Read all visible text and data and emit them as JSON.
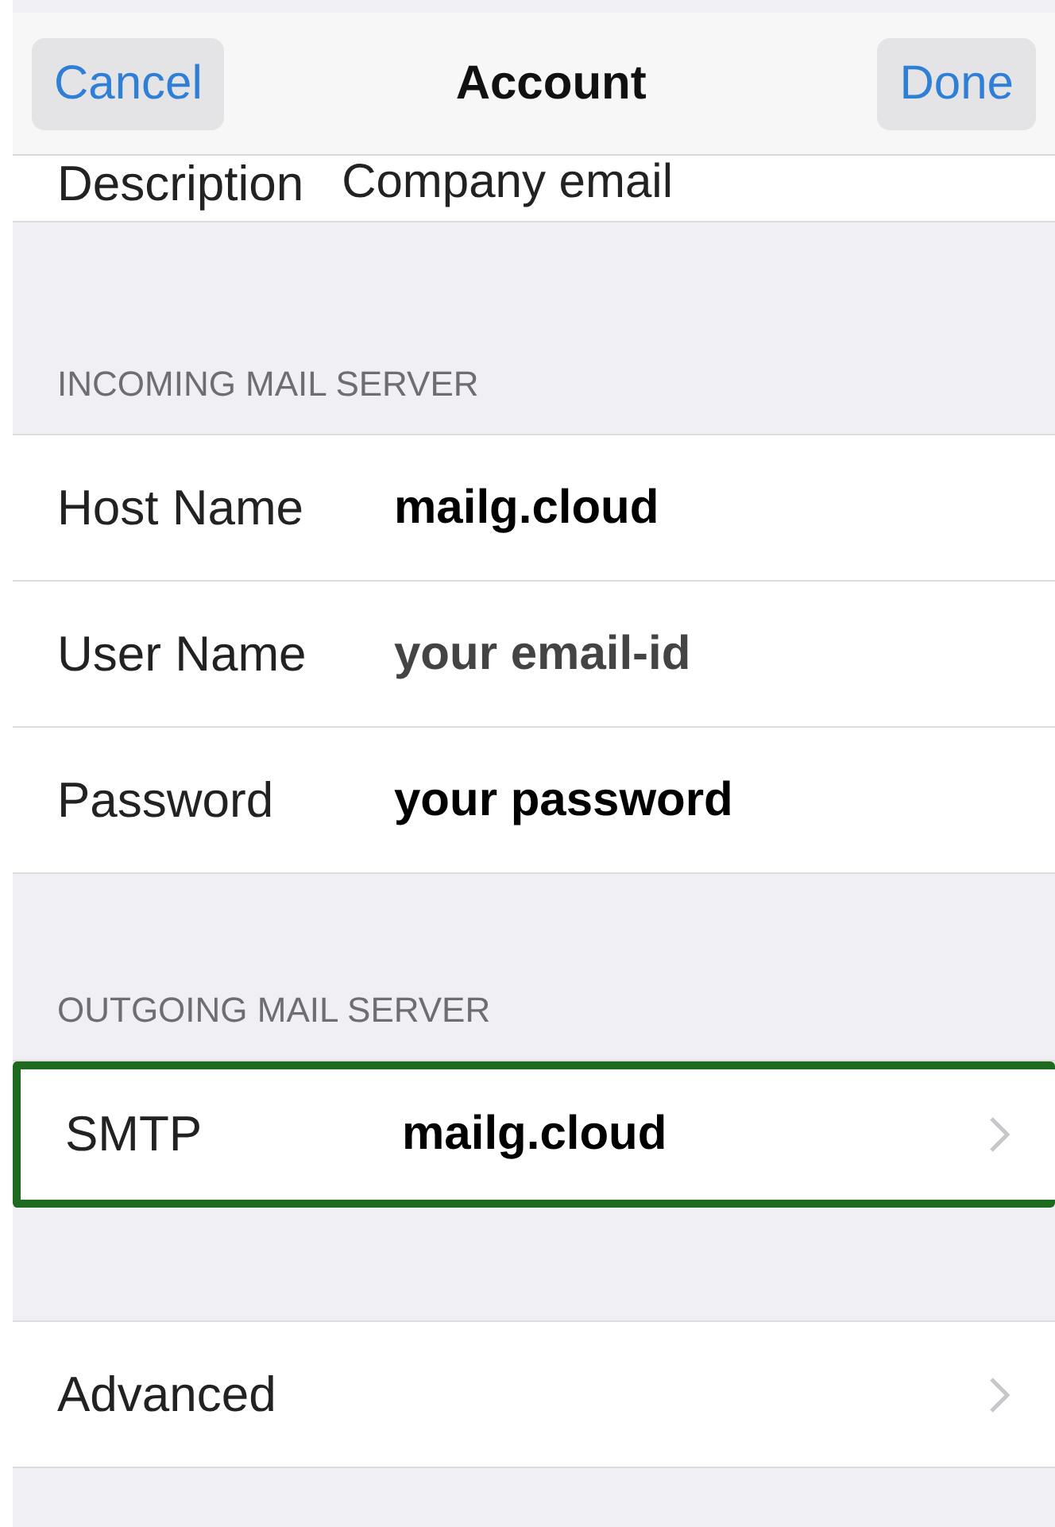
{
  "nav": {
    "cancel": "Cancel",
    "title": "Account",
    "done": "Done"
  },
  "top_row": {
    "label": "Description",
    "value": "Company email",
    "kind": "plain",
    "chevron": false,
    "highlighted": false
  },
  "sections": [
    {
      "header": "INCOMING MAIL SERVER",
      "rows": [
        {
          "label": "Host Name",
          "value": "mailg.cloud",
          "kind": "bold",
          "chevron": false,
          "highlighted": false
        },
        {
          "label": "User Name",
          "value": "your email-id",
          "kind": "bold-muted",
          "chevron": false,
          "highlighted": false
        },
        {
          "label": "Password",
          "value": "your password",
          "kind": "bold",
          "chevron": false,
          "highlighted": false
        }
      ]
    },
    {
      "header": "OUTGOING MAIL SERVER",
      "rows": [
        {
          "label": "SMTP",
          "value": "mailg.cloud",
          "kind": "bold",
          "chevron": true,
          "highlighted": true
        }
      ]
    },
    {
      "rows": [
        {
          "label": "Advanced",
          "chevron": true,
          "highlighted": false
        }
      ]
    }
  ]
}
